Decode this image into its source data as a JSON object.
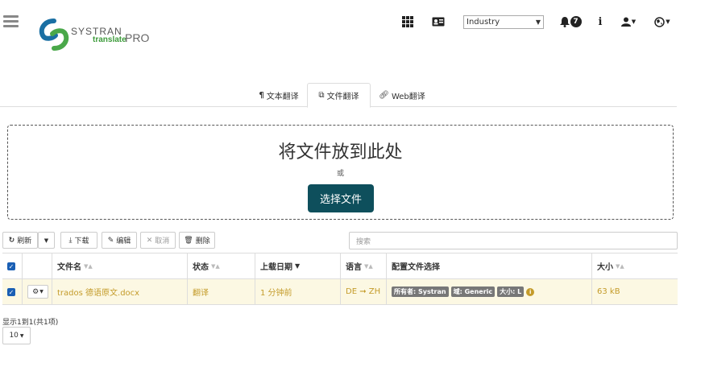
{
  "header": {
    "logo_name": "SYSTRAN",
    "logo_sub": "translate",
    "logo_pro": "PRO",
    "industry_select": "Industry",
    "notification_count": "7",
    "info_label": "i"
  },
  "tabs": [
    {
      "label": "文本翻译",
      "icon": "pilcrow-icon"
    },
    {
      "label": "文件翻译",
      "icon": "files-icon",
      "active": true
    },
    {
      "label": "Web翻译",
      "icon": "link-icon"
    }
  ],
  "dropzone": {
    "title": "将文件放到此处",
    "or": "或",
    "button": "选择文件"
  },
  "toolbar": {
    "refresh": "刷新",
    "download": "下载",
    "edit": "编辑",
    "cancel": "取消",
    "delete": "删除",
    "search_placeholder": "搜索"
  },
  "table": {
    "headers": {
      "filename": "文件名",
      "status": "状态",
      "upload_date": "上载日期",
      "language": "语言",
      "profile": "配置文件选择",
      "size": "大小"
    },
    "rows": [
      {
        "filename": "trados 德语原文.docx",
        "status": "翻译",
        "upload_date": "1 分钟前",
        "language": "DE ➞ ZH",
        "tags": [
          "所有者: Systran",
          "域: Generic",
          "大小: L"
        ],
        "size": "63 kB"
      }
    ]
  },
  "footer": {
    "summary": "显示1到1(共1项)",
    "per_page": "10"
  },
  "colors": {
    "primary_button": "#0e4f5c",
    "row_highlight": "#fcf8e3",
    "row_text": "#c49b2a",
    "checkbox": "#1a5fb4"
  }
}
